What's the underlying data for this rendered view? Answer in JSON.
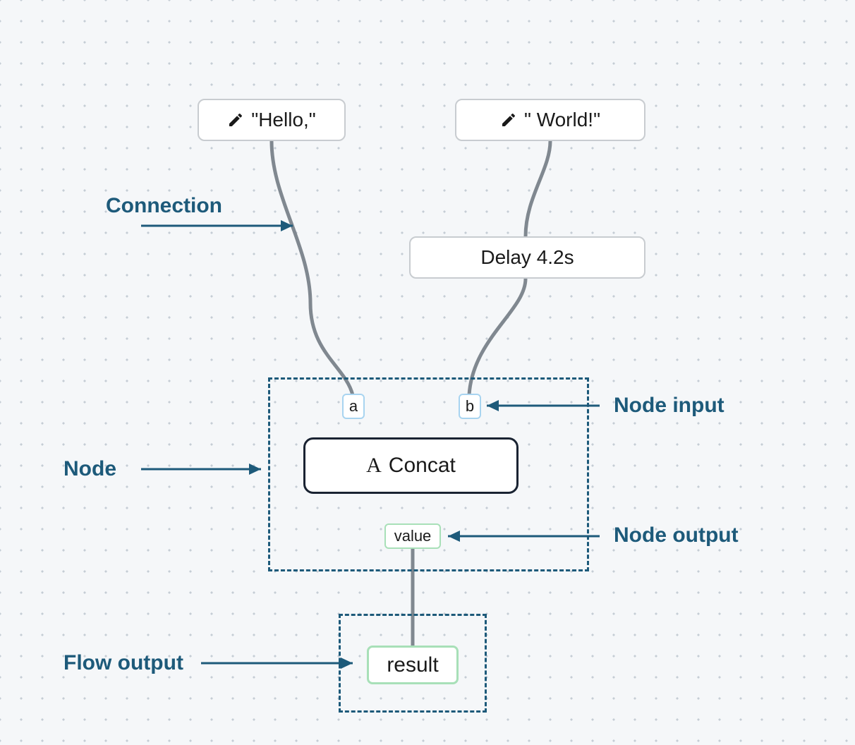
{
  "nodes": {
    "hello": {
      "label": "\"Hello,\""
    },
    "world": {
      "label": "\" World!\""
    },
    "delay": {
      "label": "Delay 4.2s"
    },
    "concat": {
      "label": "Concat",
      "icon_glyph": "A"
    },
    "result": {
      "label": "result"
    }
  },
  "ports": {
    "a": {
      "label": "a"
    },
    "b": {
      "label": "b"
    },
    "value": {
      "label": "value"
    }
  },
  "annotations": {
    "connection": "Connection",
    "node": "Node",
    "node_input": "Node input",
    "node_output": "Node output",
    "flow_output": "Flow output"
  },
  "colors": {
    "canvas_bg": "#f5f7f9",
    "dot": "#c5cdd5",
    "annotation": "#1d5a7a",
    "connection": "#808890",
    "node_border": "#c8ccd0",
    "main_node_border": "#1a2332",
    "input_port_border": "#a8d4f0",
    "output_port_border": "#a8e0b8"
  }
}
